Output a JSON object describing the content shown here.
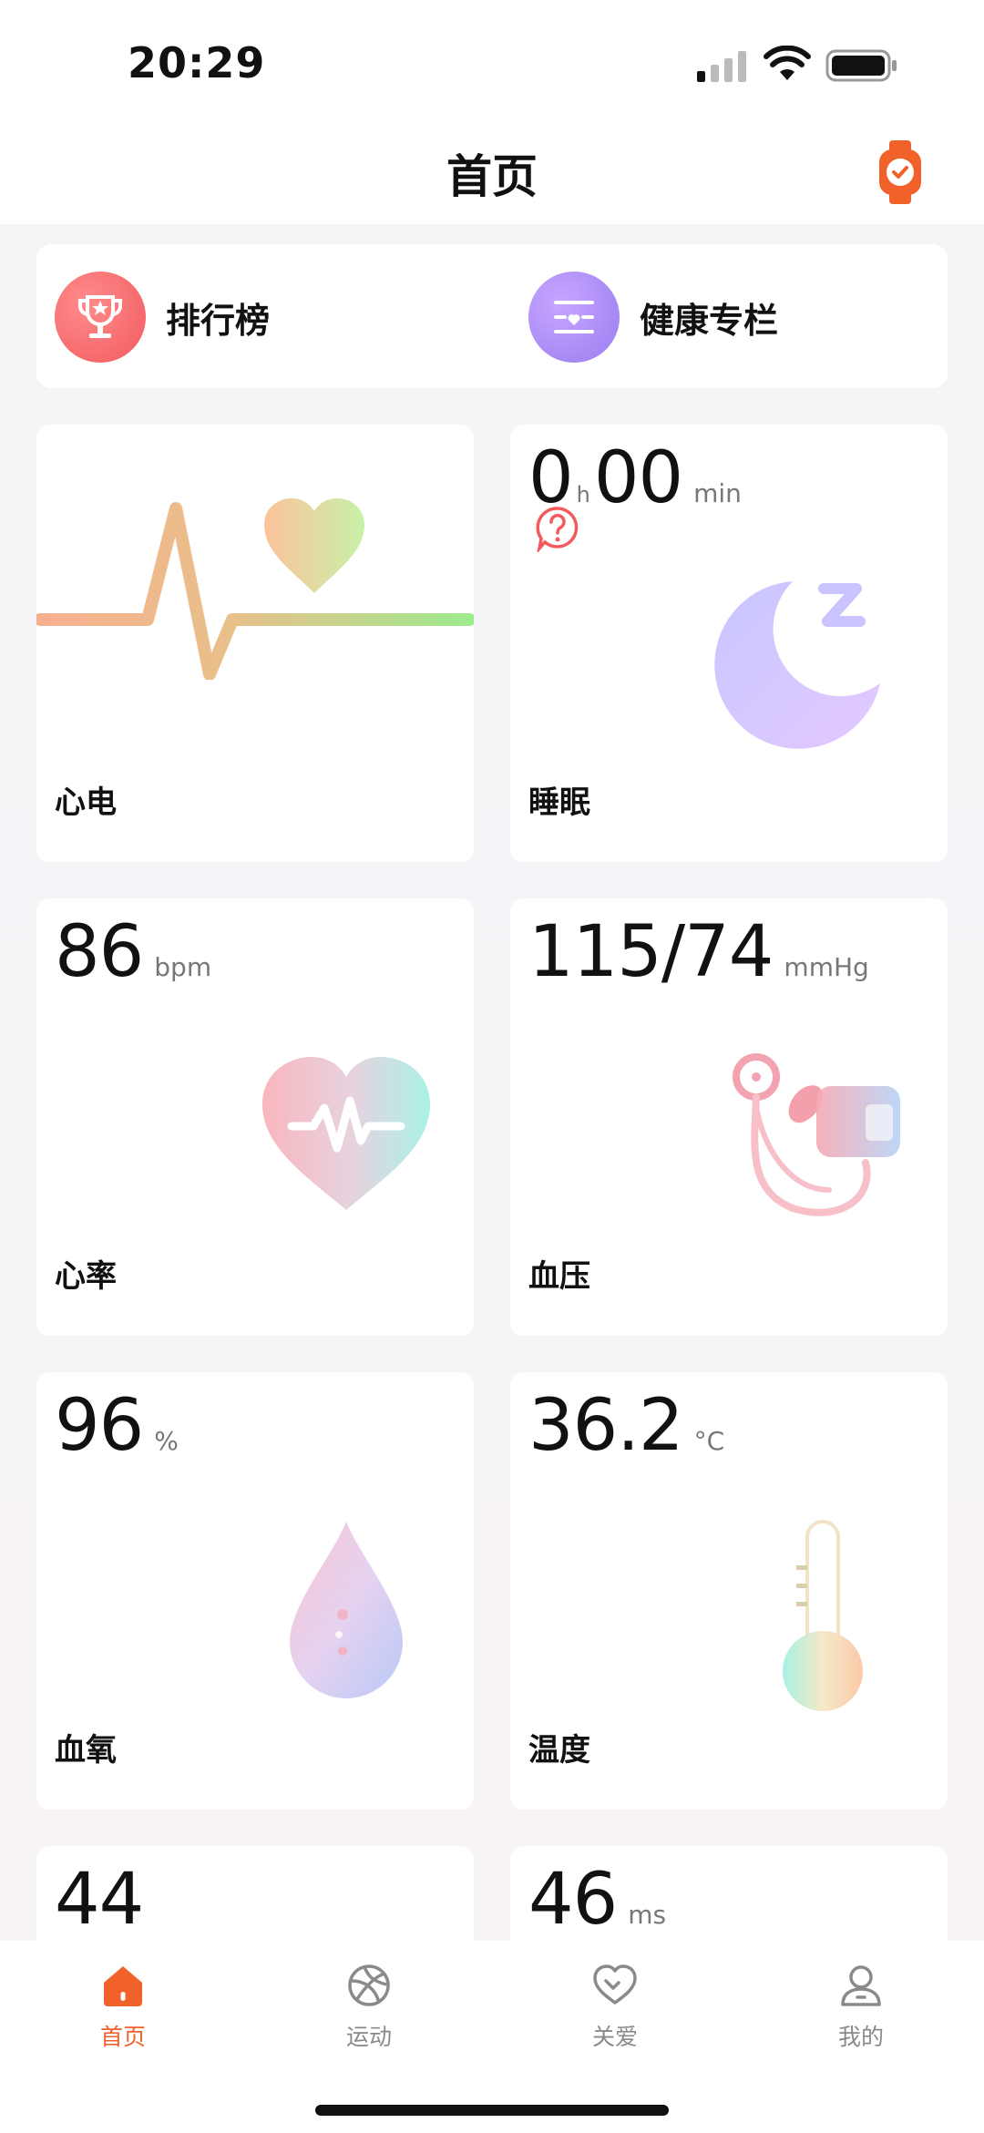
{
  "status": {
    "time": "20:29"
  },
  "header": {
    "title": "首页"
  },
  "quick_links": [
    {
      "label": "排行榜",
      "icon": "trophy-icon"
    },
    {
      "label": "健康专栏",
      "icon": "health-column-icon"
    }
  ],
  "cards": {
    "ecg": {
      "name": "心电"
    },
    "sleep": {
      "hours": "0",
      "h_unit": "h",
      "minutes": "00",
      "min_unit": "min",
      "name": "睡眠"
    },
    "heart_rate": {
      "value": "86",
      "unit": "bpm",
      "name": "心率"
    },
    "blood_pressure": {
      "value": "115/74",
      "unit": "mmHg",
      "name": "血压"
    },
    "spo2": {
      "value": "96",
      "unit": "%",
      "name": "血氧"
    },
    "temperature": {
      "value": "36.2",
      "unit": "°C",
      "name": "温度"
    },
    "card7": {
      "value": "44"
    },
    "card8": {
      "value": "46",
      "unit": "ms"
    }
  },
  "tabs": [
    {
      "label": "首页",
      "icon": "home-icon",
      "active": true
    },
    {
      "label": "运动",
      "icon": "sport-ball-icon",
      "active": false
    },
    {
      "label": "关爱",
      "icon": "care-heart-icon",
      "active": false
    },
    {
      "label": "我的",
      "icon": "profile-icon",
      "active": false
    }
  ],
  "colors": {
    "accent": "#f0622a",
    "text": "#111111",
    "muted": "#8a8a8a"
  }
}
